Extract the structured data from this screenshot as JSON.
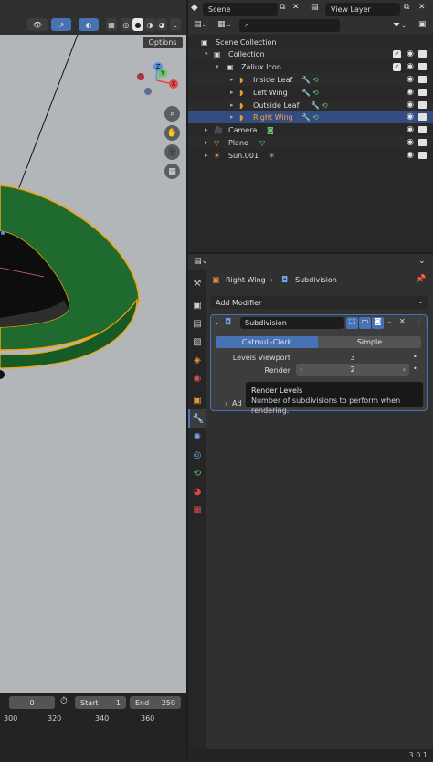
{
  "viewport": {
    "options_label": "Options",
    "gizmo": {
      "z": "Z",
      "y": "Y",
      "x": "X"
    }
  },
  "timeline": {
    "current_frame": "0",
    "start_label": "Start",
    "start_value": "1",
    "end_label": "End",
    "end_value": "250",
    "ruler": [
      "300",
      "320",
      "340",
      "360"
    ]
  },
  "outliner": {
    "scene_label": "Scene",
    "view_layer_label": "View Layer",
    "rows": [
      {
        "label": "Scene Collection"
      },
      {
        "label": "Collection"
      },
      {
        "label": "Zaliux Icon"
      },
      {
        "label": "Inside Leaf"
      },
      {
        "label": "Left Wing"
      },
      {
        "label": "Outside Leaf"
      },
      {
        "label": "Right Wing"
      },
      {
        "label": "Camera"
      },
      {
        "label": "Plane"
      },
      {
        "label": "Sun.001"
      }
    ]
  },
  "properties": {
    "breadcrumb_object": "Right Wing",
    "breadcrumb_modifier": "Subdivision",
    "add_modifier_label": "Add Modifier",
    "modifier_name": "Subdivision",
    "mode_catmull": "Catmull-Clark",
    "mode_simple": "Simple",
    "levels_viewport_label": "Levels Viewport",
    "levels_viewport_value": "3",
    "render_label": "Render",
    "render_value": "2",
    "advanced_label": "Ad",
    "tooltip_title": "Render Levels",
    "tooltip_body": "Number of subdivisions to perform when rendering."
  },
  "status": {
    "version": "3.0.1"
  },
  "colors": {
    "accent": "#4772b3",
    "object_green": "#1f6b2f",
    "selection_orange": "#f2a20a"
  }
}
